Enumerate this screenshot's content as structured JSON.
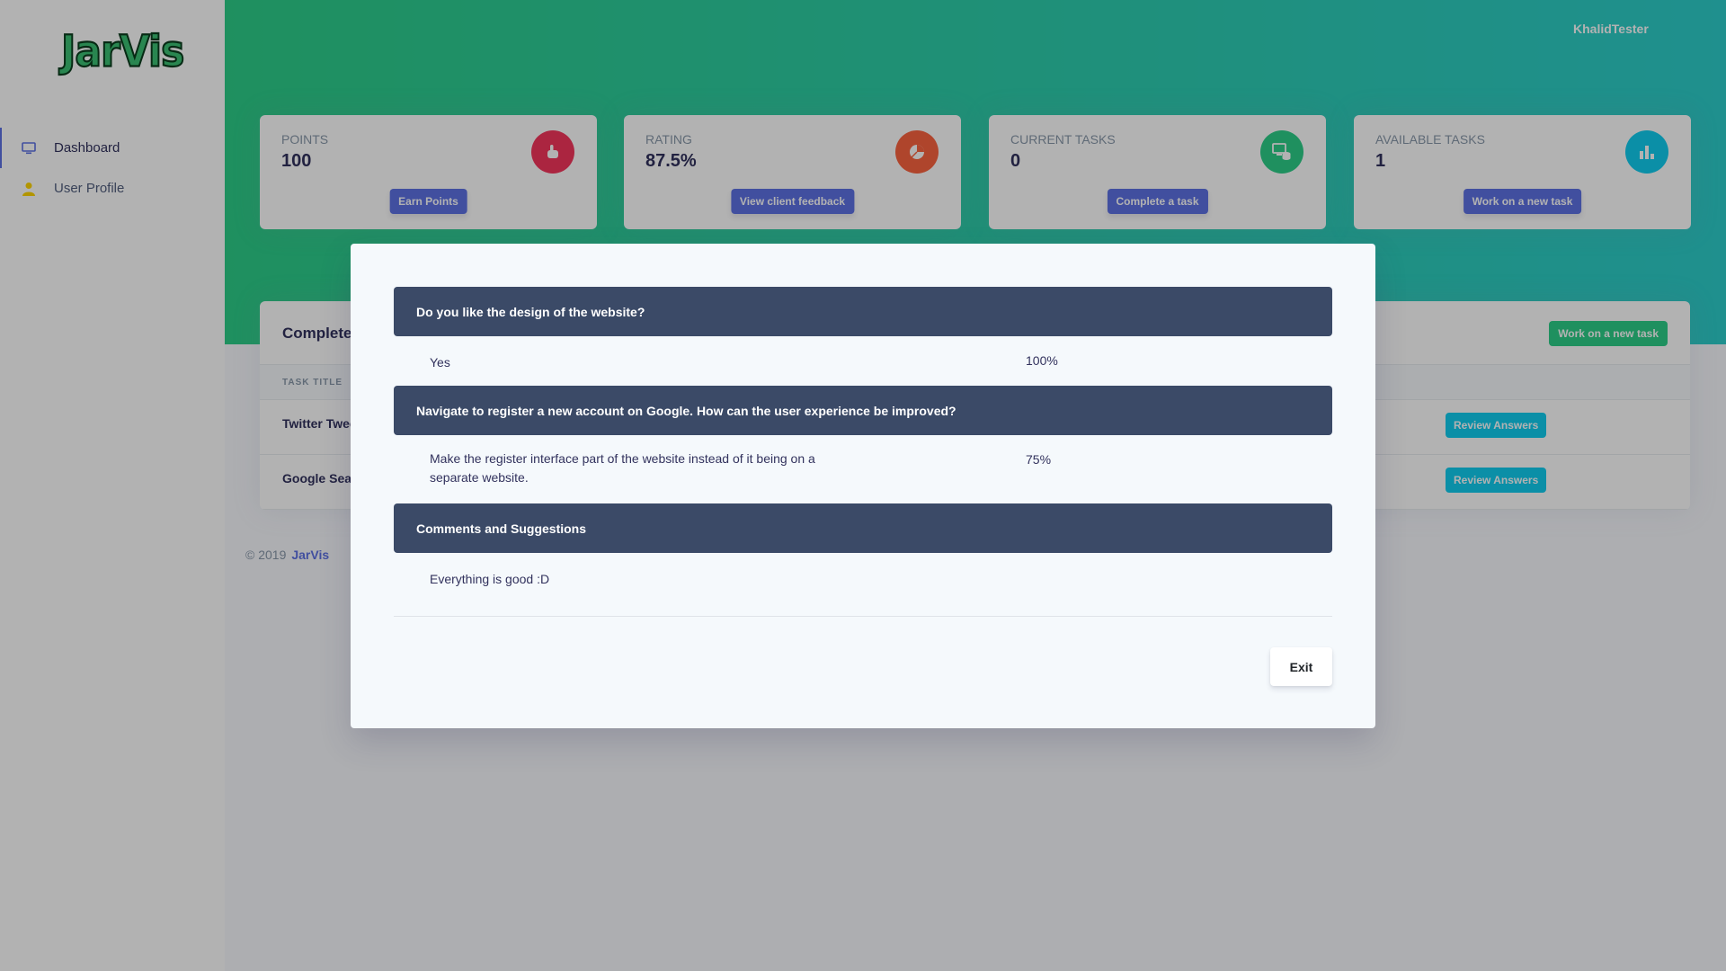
{
  "app": {
    "logo": "JarVis",
    "username": "KhalidTester"
  },
  "sidebar": {
    "items": [
      {
        "label": "Dashboard",
        "icon": "monitor-icon",
        "active": true
      },
      {
        "label": "User Profile",
        "icon": "user-icon",
        "active": false
      }
    ]
  },
  "stats": [
    {
      "title": "POINTS",
      "value": "100",
      "button": "Earn Points",
      "icon": "hand-pointer-icon",
      "color": "#f5365c"
    },
    {
      "title": "RATING",
      "value": "87.5%",
      "button": "View client feedback",
      "icon": "pie-chart-icon",
      "color": "#fb6340"
    },
    {
      "title": "CURRENT TASKS",
      "value": "0",
      "button": "Complete a task",
      "icon": "tasks-icon",
      "color": "#2dce89"
    },
    {
      "title": "AVAILABLE TASKS",
      "value": "1",
      "button": "Work on a new task",
      "icon": "bar-chart-icon",
      "color": "#11cdef"
    }
  ],
  "table": {
    "title": "Complete",
    "new_task_button": "Work on a new task",
    "column_header": "TASK TITLE",
    "rows": [
      {
        "title": "Twitter Twee",
        "action": "Review Answers"
      },
      {
        "title": "Google Sear",
        "action": "Review Answers"
      }
    ]
  },
  "footer": {
    "copyright": "© 2019",
    "brand": "JarVis"
  },
  "modal": {
    "questions": [
      {
        "question": "Do you like the design of the website?",
        "answer": "Yes",
        "percent": "100%"
      },
      {
        "question": "Navigate to register a new account on Google. How can the user experience be improved?",
        "answer_line1": "Make the register interface part of the website instead of it being on a",
        "answer_line2": "separate website.",
        "percent": "75%"
      },
      {
        "question": "Comments and Suggestions",
        "answer": "Everything is good :D"
      }
    ],
    "exit_button": "Exit"
  }
}
